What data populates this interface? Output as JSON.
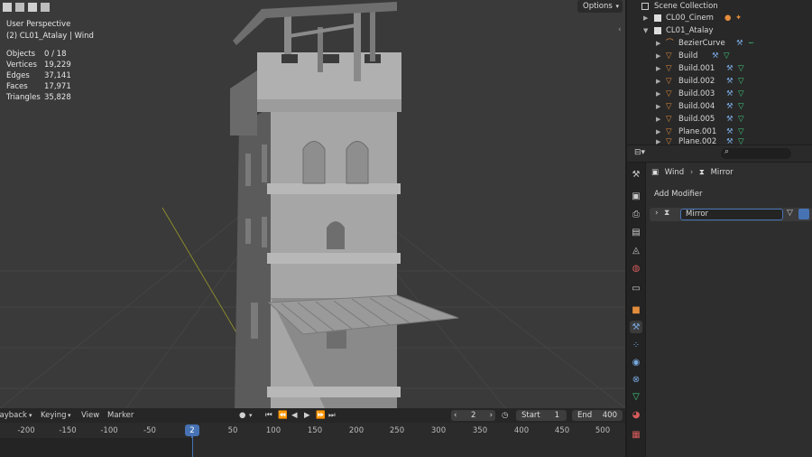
{
  "viewport": {
    "perspective": "User Perspective",
    "context": "(2) CL01_Atalay | Wind",
    "options_label": "Options",
    "stats": [
      {
        "label": "Objects",
        "value": "0 / 18"
      },
      {
        "label": "Vertices",
        "value": "19,229"
      },
      {
        "label": "Edges",
        "value": "37,141"
      },
      {
        "label": "Faces",
        "value": "17,971"
      },
      {
        "label": "Triangles",
        "value": "35,828"
      }
    ]
  },
  "outliner": {
    "root": "Scene Collection",
    "items": [
      {
        "name": "CL00_Cinem",
        "icon": "collection-icon"
      },
      {
        "name": "CL01_Atalay",
        "icon": "collection-icon"
      },
      {
        "name": "BezierCurve",
        "icon": "curve-icon"
      },
      {
        "name": "Build",
        "icon": "mesh-icon"
      },
      {
        "name": "Build.001",
        "icon": "mesh-icon"
      },
      {
        "name": "Build.002",
        "icon": "mesh-icon"
      },
      {
        "name": "Build.003",
        "icon": "mesh-icon"
      },
      {
        "name": "Build.004",
        "icon": "mesh-icon"
      },
      {
        "name": "Build.005",
        "icon": "mesh-icon"
      },
      {
        "name": "Plane.001",
        "icon": "mesh-icon"
      },
      {
        "name": "Plane.002",
        "icon": "mesh-icon"
      }
    ]
  },
  "properties": {
    "breadcrumb_object": "Wind",
    "breadcrumb_modifier": "Mirror",
    "add_modifier_label": "Add Modifier",
    "modifier_name": "Mirror"
  },
  "timeline": {
    "menu": [
      "Playback",
      "Keying",
      "View",
      "Marker"
    ],
    "current_frame": "2",
    "start_label": "Start",
    "start_value": "1",
    "end_label": "End",
    "end_value": "400",
    "ticks": [
      "-200",
      "-150",
      "-100",
      "-50",
      "2",
      "50",
      "100",
      "150",
      "200",
      "250",
      "300",
      "350",
      "400",
      "450",
      "500"
    ]
  },
  "colors": {
    "accent_blue": "#4772b3",
    "mesh_orange": "#e38d3c",
    "modifier_blue": "#78a9e0",
    "vertex_green": "#3fd07f"
  }
}
